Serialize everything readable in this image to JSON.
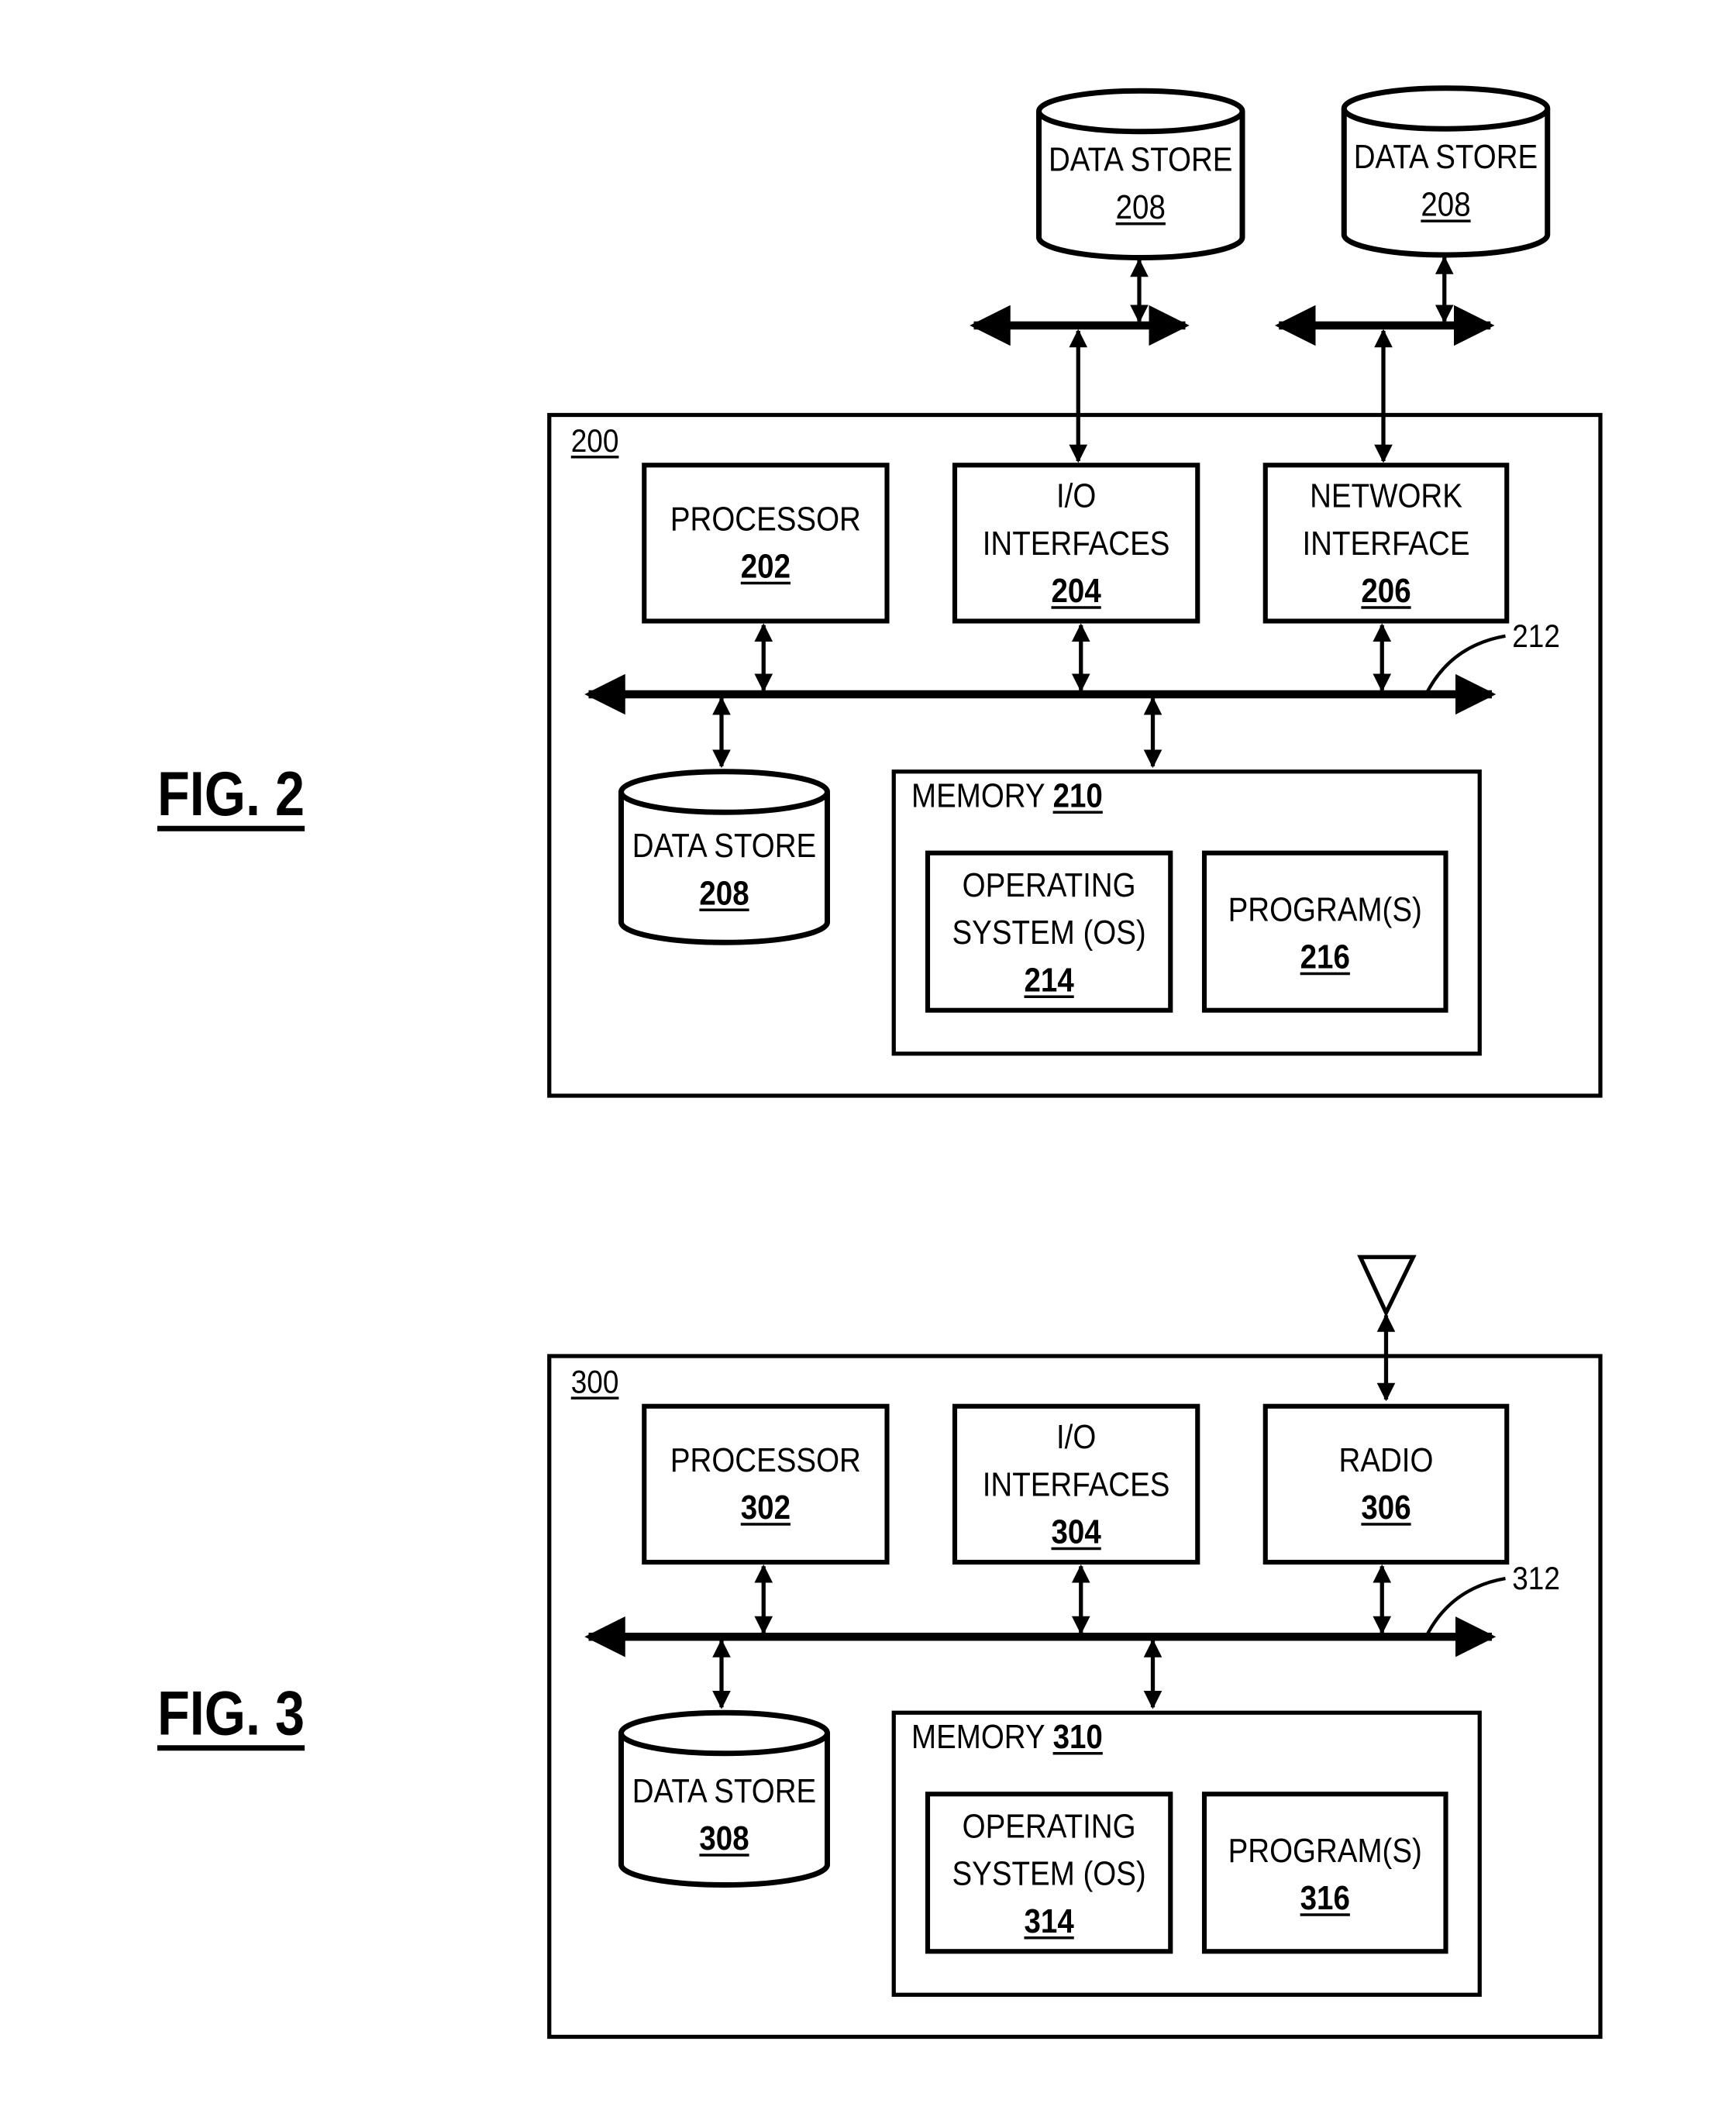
{
  "figures": [
    {
      "id": "fig2",
      "caption": "FIG. 2",
      "device_ref": "200",
      "bus_ref": "212",
      "processor": {
        "label": "PROCESSOR",
        "num": "202"
      },
      "io": {
        "line1": "I/O",
        "line2": "INTERFACES",
        "num": "204"
      },
      "network": {
        "line1": "NETWORK",
        "line2": "INTERFACE",
        "num": "206"
      },
      "external_store_1": {
        "label": "DATA STORE",
        "num": "208"
      },
      "external_store_2": {
        "label": "DATA STORE",
        "num": "208"
      },
      "internal_store": {
        "label": "DATA STORE",
        "num": "208"
      },
      "memory": {
        "label": "MEMORY",
        "num": "210"
      },
      "os": {
        "line1": "OPERATING",
        "line2": "SYSTEM (OS)",
        "num": "214"
      },
      "programs": {
        "label": "PROGRAM(S)",
        "num": "216"
      }
    },
    {
      "id": "fig3",
      "caption": "FIG. 3",
      "device_ref": "300",
      "bus_ref": "312",
      "processor": {
        "label": "PROCESSOR",
        "num": "302"
      },
      "io": {
        "line1": "I/O",
        "line2": "INTERFACES",
        "num": "304"
      },
      "radio": {
        "label": "RADIO",
        "num": "306"
      },
      "internal_store": {
        "label": "DATA STORE",
        "num": "308"
      },
      "memory": {
        "label": "MEMORY",
        "num": "310"
      },
      "os": {
        "line1": "OPERATING",
        "line2": "SYSTEM (OS)",
        "num": "314"
      },
      "programs": {
        "label": "PROGRAM(S)",
        "num": "316"
      }
    }
  ]
}
